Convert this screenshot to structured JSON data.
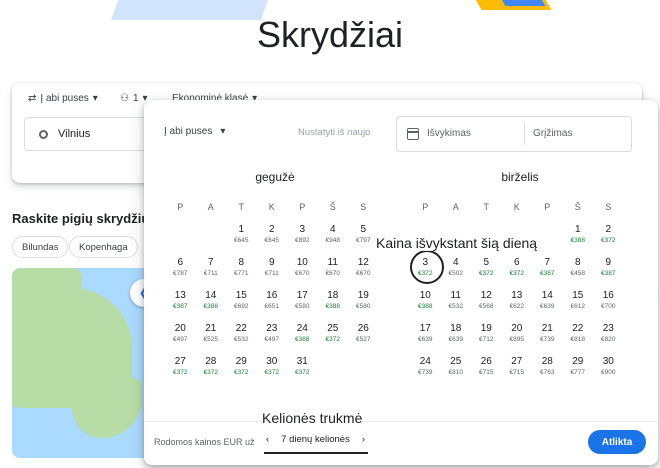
{
  "page_title": "Skrydžiai",
  "search": {
    "trip_type": "Į abi puses",
    "passengers": "1",
    "class": "Ekonominė klasė",
    "origin": "Vilnius"
  },
  "cheap_flights_heading": "Raskite pigių skrydžių",
  "chips": [
    "Bilundas",
    "Kopenhaga"
  ],
  "dialog": {
    "trip_type": "Į abi puses",
    "reset": "Nustatyti iš naujo",
    "departure_placeholder": "Išvykimas",
    "return_placeholder": "Grįžimas",
    "weekdays": [
      "P",
      "A",
      "T",
      "K",
      "P",
      "Š",
      "S"
    ],
    "months": [
      {
        "name": "gegužė",
        "weeks": [
          [
            {
              "d": "",
              "p": ""
            },
            {
              "d": "",
              "p": ""
            },
            {
              "d": "1",
              "p": "€645"
            },
            {
              "d": "2",
              "p": "€645"
            },
            {
              "d": "3",
              "p": "€892"
            },
            {
              "d": "4",
              "p": "€948"
            },
            {
              "d": "5",
              "p": "€797"
            }
          ],
          [
            {
              "d": "6",
              "p": "€787"
            },
            {
              "d": "7",
              "p": "€711"
            },
            {
              "d": "8",
              "p": "€771"
            },
            {
              "d": "9",
              "p": "€711"
            },
            {
              "d": "10",
              "p": "€670"
            },
            {
              "d": "11",
              "p": "€670"
            },
            {
              "d": "12",
              "p": "€670"
            }
          ],
          [
            {
              "d": "13",
              "p": "€387",
              "low": true
            },
            {
              "d": "14",
              "p": "€388",
              "low": true
            },
            {
              "d": "15",
              "p": "€692"
            },
            {
              "d": "16",
              "p": "€651"
            },
            {
              "d": "17",
              "p": "€580"
            },
            {
              "d": "18",
              "p": "€388",
              "low": true
            },
            {
              "d": "19",
              "p": "€580"
            }
          ],
          [
            {
              "d": "20",
              "p": "€497"
            },
            {
              "d": "21",
              "p": "€525"
            },
            {
              "d": "22",
              "p": "€532"
            },
            {
              "d": "23",
              "p": "€497"
            },
            {
              "d": "24",
              "p": "€388",
              "low": true
            },
            {
              "d": "25",
              "p": "€372",
              "low": true
            },
            {
              "d": "26",
              "p": "€527"
            }
          ],
          [
            {
              "d": "27",
              "p": "€372",
              "low": true
            },
            {
              "d": "28",
              "p": "€372",
              "low": true
            },
            {
              "d": "29",
              "p": "€372",
              "low": true
            },
            {
              "d": "30",
              "p": "€372",
              "low": true
            },
            {
              "d": "31",
              "p": "€372",
              "low": true
            },
            {
              "d": "",
              "p": ""
            },
            {
              "d": "",
              "p": ""
            }
          ]
        ]
      },
      {
        "name": "birželis",
        "weeks": [
          [
            {
              "d": "",
              "p": ""
            },
            {
              "d": "",
              "p": ""
            },
            {
              "d": "",
              "p": ""
            },
            {
              "d": "",
              "p": ""
            },
            {
              "d": "",
              "p": ""
            },
            {
              "d": "1",
              "p": "€388",
              "low": true
            },
            {
              "d": "2",
              "p": "€372",
              "low": true
            }
          ],
          [
            {
              "d": "3",
              "p": "€372",
              "low": true,
              "circled": true
            },
            {
              "d": "4",
              "p": "€502"
            },
            {
              "d": "5",
              "p": "€372",
              "low": true
            },
            {
              "d": "6",
              "p": "€372",
              "low": true
            },
            {
              "d": "7",
              "p": "€387",
              "low": true
            },
            {
              "d": "8",
              "p": "€458"
            },
            {
              "d": "9",
              "p": "€387",
              "low": true
            }
          ],
          [
            {
              "d": "10",
              "p": "€388",
              "low": true
            },
            {
              "d": "11",
              "p": "€532"
            },
            {
              "d": "12",
              "p": "€568"
            },
            {
              "d": "13",
              "p": "€622"
            },
            {
              "d": "14",
              "p": "€639"
            },
            {
              "d": "15",
              "p": "€612"
            },
            {
              "d": "16",
              "p": "€700"
            }
          ],
          [
            {
              "d": "17",
              "p": "€639"
            },
            {
              "d": "18",
              "p": "€639"
            },
            {
              "d": "19",
              "p": "€712"
            },
            {
              "d": "20",
              "p": "€895"
            },
            {
              "d": "21",
              "p": "€739"
            },
            {
              "d": "22",
              "p": "€818"
            },
            {
              "d": "23",
              "p": "€820"
            }
          ],
          [
            {
              "d": "24",
              "p": "€739"
            },
            {
              "d": "25",
              "p": "€810"
            },
            {
              "d": "26",
              "p": "€715"
            },
            {
              "d": "27",
              "p": "€715"
            },
            {
              "d": "28",
              "p": "€763"
            },
            {
              "d": "29",
              "p": "€777"
            },
            {
              "d": "30",
              "p": "€900"
            }
          ]
        ]
      }
    ],
    "footer_note": "Rodomos kainos EUR už",
    "duration": "7 dienų kelionės",
    "done": "Atlikta"
  },
  "annotations": {
    "price_hint": "Kaina išvykstant šią dieną",
    "trip_length": "Kelionės trukmė"
  },
  "colors": {
    "accent": "#1a73e8",
    "low_price": "#188038"
  }
}
